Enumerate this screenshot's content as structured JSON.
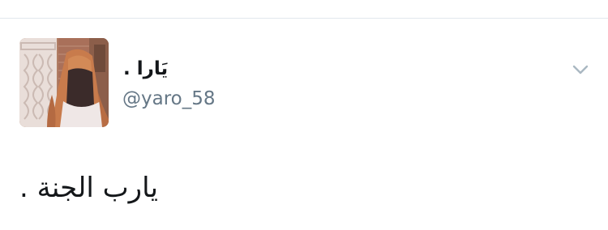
{
  "tweet": {
    "author": {
      "display_name": "يَارا .",
      "handle": "@yaro_58",
      "avatar_icon": "profile-photo"
    },
    "text": "يارب الجنة .",
    "menu_icon": "chevron-down-icon"
  },
  "colors": {
    "text_primary": "#14171a",
    "text_secondary": "#657786",
    "divider": "#e1e8ed",
    "caret": "#aab8c2"
  }
}
